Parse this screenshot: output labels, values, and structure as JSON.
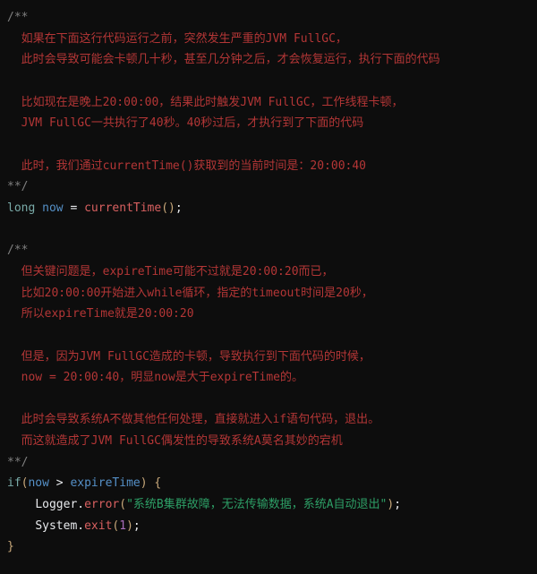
{
  "code": {
    "c1": {
      "open": "/**",
      "l1": "  如果在下面这行代码运行之前，突然发生严重的JVM FullGC，",
      "l2": "  此时会导致可能会卡顿几十秒，甚至几分钟之后，才会恢复运行，执行下面的代码",
      "l3": "  比如现在是晚上20:00:00，结果此时触发JVM FullGC，工作线程卡顿，",
      "l4": "  JVM FullGC一共执行了40秒。40秒过后，才执行到了下面的代码",
      "l5": "  此时，我们通过currentTime()获取到的当前时间是：20:00:40",
      "close": "**/"
    },
    "stmt1": {
      "type": "long",
      "name": "now",
      "eq": "=",
      "fn": "currentTime",
      "lp": "(",
      "rp": ")",
      "semi": ";"
    },
    "c2": {
      "open": "/**",
      "l1": "  但关键问题是，expireTime可能不过就是20:00:20而已，",
      "l2": "  比如20:00:00开始进入while循环，指定的timeout时间是20秒，",
      "l3": "  所以expireTime就是20:00:20",
      "l4": "  但是，因为JVM FullGC造成的卡顿，导致执行到下面代码的时候，",
      "l5": "  now = 20:00:40，明显now是大于expireTime的。",
      "l6": "  此时会导致系统A不做其他任何处理，直接就进入if语句代码，退出。",
      "l7": "  而这就造成了JVM FullGC偶发性的导致系统A莫名其妙的宕机",
      "close": "**/"
    },
    "ifstmt": {
      "kw": "if",
      "lp": "(",
      "a": "now",
      "op": ">",
      "b": "expireTime",
      "rp": ")",
      "lb": "{",
      "logger": {
        "cls": "Logger",
        "dot": ".",
        "m": "error",
        "lp": "(",
        "str": "\"系统B集群故障，无法传输数据，系统A自动退出\"",
        "rp": ")",
        "semi": ";"
      },
      "exit": {
        "cls": "System",
        "dot": ".",
        "m": "exit",
        "lp": "(",
        "n": "1",
        "rp": ")",
        "semi": ";"
      },
      "rb": "}"
    }
  }
}
